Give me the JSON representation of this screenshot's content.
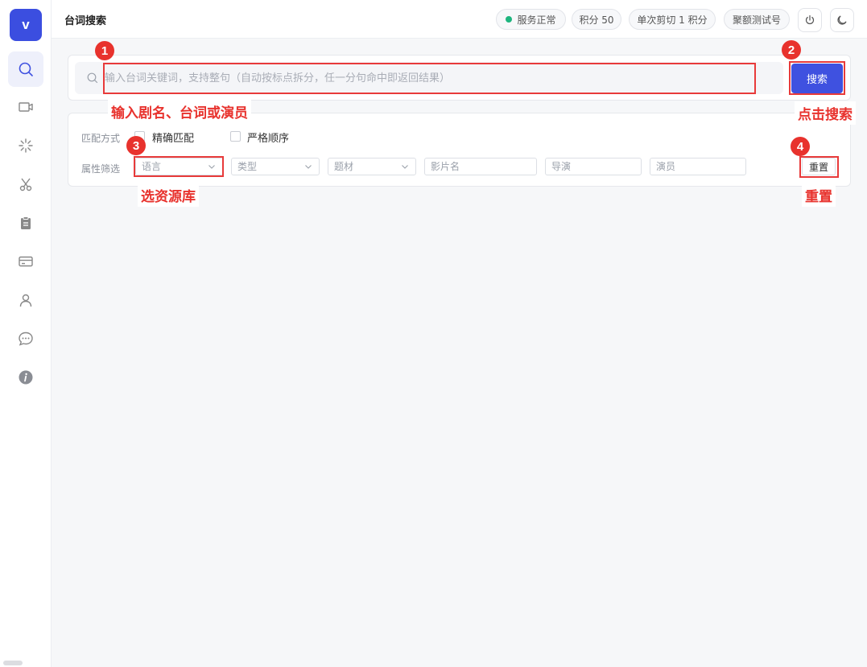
{
  "app": {
    "logo_letter": "v"
  },
  "header": {
    "title": "台词搜索",
    "status": "服务正常",
    "points": "积分 50",
    "cost": "单次剪切 1 积分",
    "account": "聚额测试号"
  },
  "colors": {
    "accent": "#3f51e0",
    "status_ok": "#1db57e",
    "annotation": "#e8322d"
  },
  "sidebar": {
    "items": [
      {
        "name": "search-icon",
        "active": true
      },
      {
        "name": "video-icon"
      },
      {
        "name": "loading-icon"
      },
      {
        "name": "scissors-icon"
      },
      {
        "name": "clipboard-icon"
      },
      {
        "name": "card-icon"
      },
      {
        "name": "user-icon"
      },
      {
        "name": "chat-icon"
      },
      {
        "name": "info-icon"
      }
    ]
  },
  "search": {
    "placeholder": "输入台词关键词，支持整句（自动按标点拆分，任一分句命中即返回结果）",
    "button": "搜索"
  },
  "filters": {
    "match_label": "匹配方式",
    "exact_match": "精确匹配",
    "strict_order": "严格顺序",
    "attr_label": "属性筛选",
    "language": "语言",
    "genre": "类型",
    "theme": "题材",
    "title_placeholder": "影片名",
    "director_placeholder": "导演",
    "actor_placeholder": "演员",
    "reset": "重置"
  },
  "annotations": [
    {
      "num": "1",
      "text": "输入剧名、台词或演员"
    },
    {
      "num": "2",
      "text": "点击搜索"
    },
    {
      "num": "3",
      "text": "选资源库"
    },
    {
      "num": "4",
      "text": "重置"
    }
  ]
}
